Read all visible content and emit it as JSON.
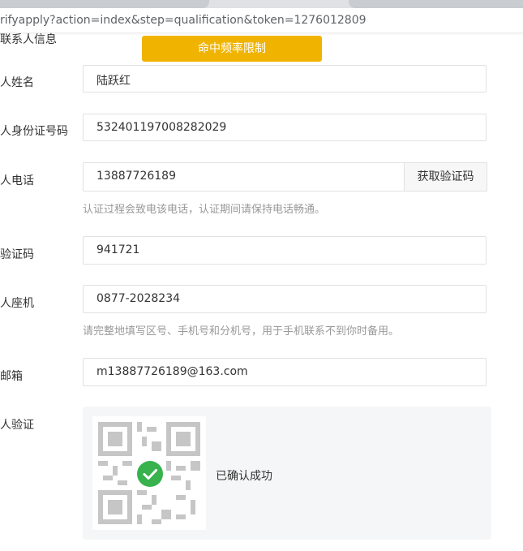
{
  "browser": {
    "url": "rifyapply?action=index&step=qualification&token=1276012809"
  },
  "form": {
    "section_label_cut": "联系人信息",
    "hit_limit_button": "命中频率限制",
    "fields": {
      "name": {
        "label": "人姓名",
        "value": "陆跃红"
      },
      "id_number": {
        "label": "人身份证号码",
        "value": "532401197008282029"
      },
      "phone": {
        "label": "人电话",
        "value": "13887726189",
        "button": "获取验证码",
        "hint": "认证过程会致电该电话，认证期间请保持电话畅通。"
      },
      "code": {
        "label": "验证码",
        "value": "941721"
      },
      "landline": {
        "label": "人座机",
        "value": "0877-2028234",
        "hint": "请完整地填写区号、手机号和分机号，用于手机联系不到你时备用。"
      },
      "email": {
        "label": "邮箱",
        "value": "m13887726189@163.com"
      },
      "verify": {
        "label": "人验证",
        "status": "已确认成功"
      }
    }
  },
  "colors": {
    "accent": "#f0b400",
    "success": "#37b24d"
  }
}
